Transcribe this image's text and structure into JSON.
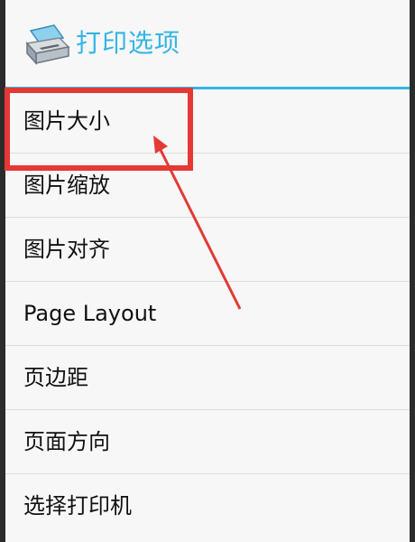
{
  "dialog": {
    "title": "打印选项",
    "title_icon": "printer-icon",
    "accent_color": "#33b5e5"
  },
  "menu": {
    "items": [
      {
        "label": "图片大小",
        "highlighted": true
      },
      {
        "label": "图片缩放"
      },
      {
        "label": "图片对齐"
      },
      {
        "label": "Page Layout"
      },
      {
        "label": "页边距"
      },
      {
        "label": "页面方向"
      },
      {
        "label": "选择打印机"
      }
    ]
  },
  "annotation": {
    "color": "#e53935",
    "highlight_box": "red-rectangle",
    "arrow": "red-arrow"
  }
}
